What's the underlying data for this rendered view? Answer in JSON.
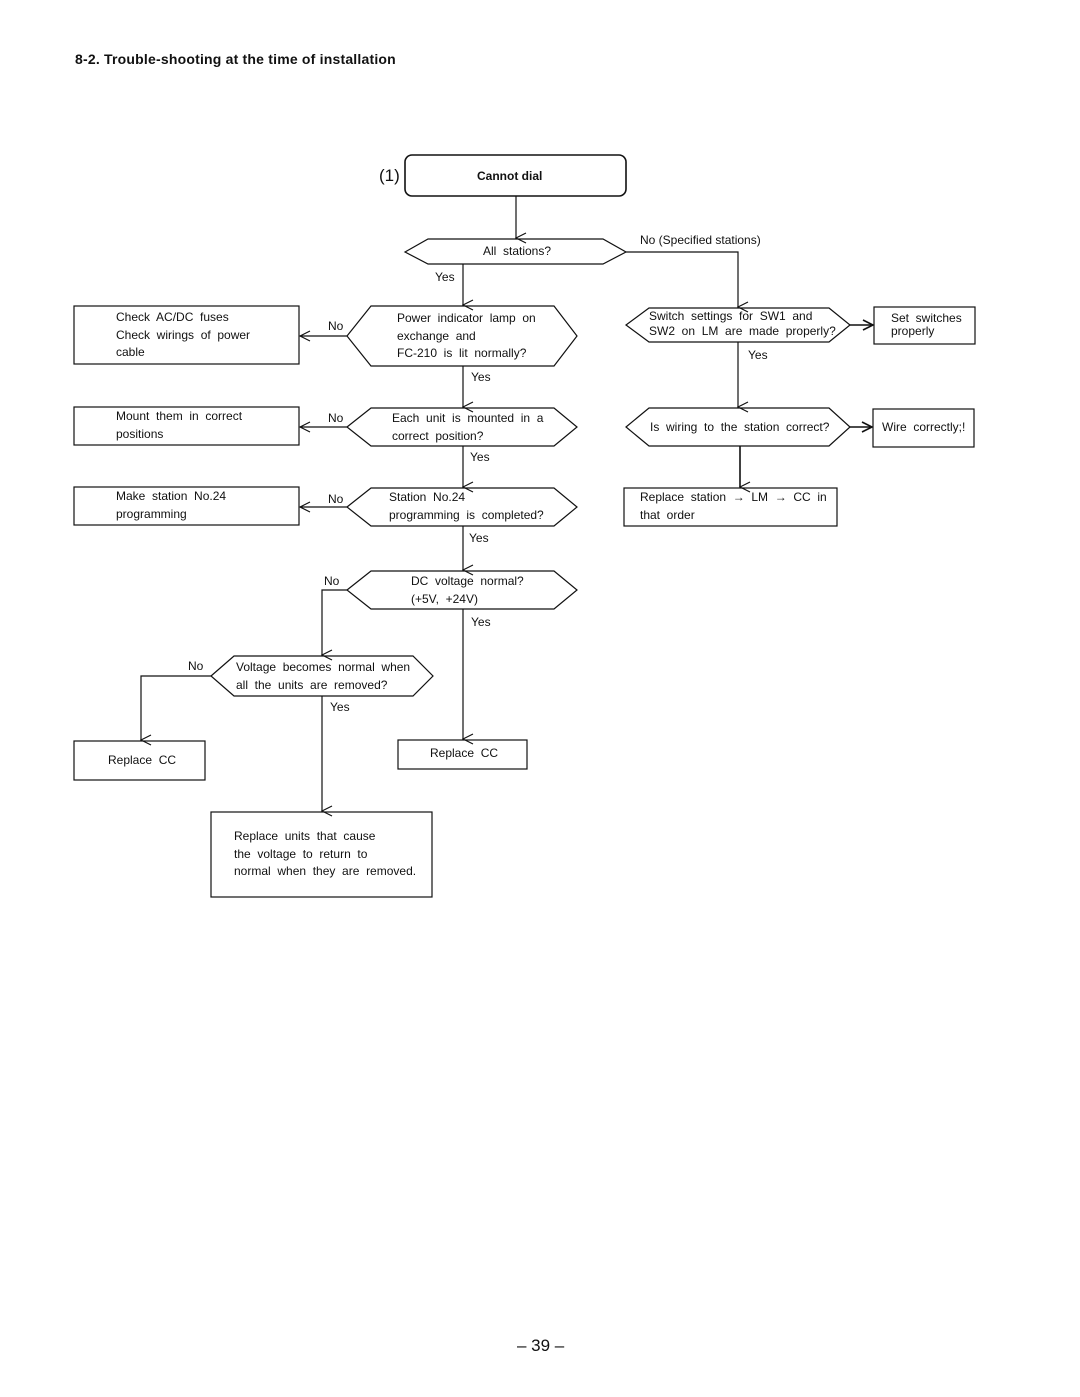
{
  "page": {
    "section_title": "8-2.  Trouble-shooting  at  the  time  of  installation",
    "page_number": "– 39 –"
  },
  "flowchart": {
    "start_marker": "(1)",
    "start": "Cannot  dial",
    "decisions": {
      "all_stations": "All  stations?",
      "power_lamp": "Power  indicator  lamp  on\nexchange  and\nFC-210  is  lit  normally?",
      "unit_mounted": "Each  unit  is  mounted  in  a\ncorrect  position?",
      "station24": "Station  No.24\nprogramming  is  completed?",
      "dc_voltage": "DC  voltage  normal?\n(+5V,  +24V)",
      "voltage_removed": "Voltage  becomes  normal  when\nall  the  units  are  removed?",
      "switch_settings": "Switch  settings  for  SW1  and\nSW2  on  LM  are  made  properly?",
      "wiring": "Is  wiring  to  the  station  correct?"
    },
    "actions": {
      "check_fuses": "Check  AC/DC  fuses\nCheck  wirings  of  power\ncable",
      "mount": "Mount  them  in  correct\npositions",
      "make_station24": "Make  station  No.24\nprogramming",
      "replace_cc_left": "Replace  CC",
      "replace_cc_center": "Replace  CC",
      "replace_units": "Replace  units  that  cause\nthe  voltage  to  return  to\nnormal  when  they  are  removed.",
      "set_switches": "Set  switches\nproperly",
      "wire_correctly": "Wire  correctly;!",
      "replace_station": "Replace  station  →  LM  →  CC  in\nthat  order"
    },
    "labels": {
      "no_specified": "No      (Specified  stations)",
      "yes": "Yes",
      "no": "No"
    }
  }
}
